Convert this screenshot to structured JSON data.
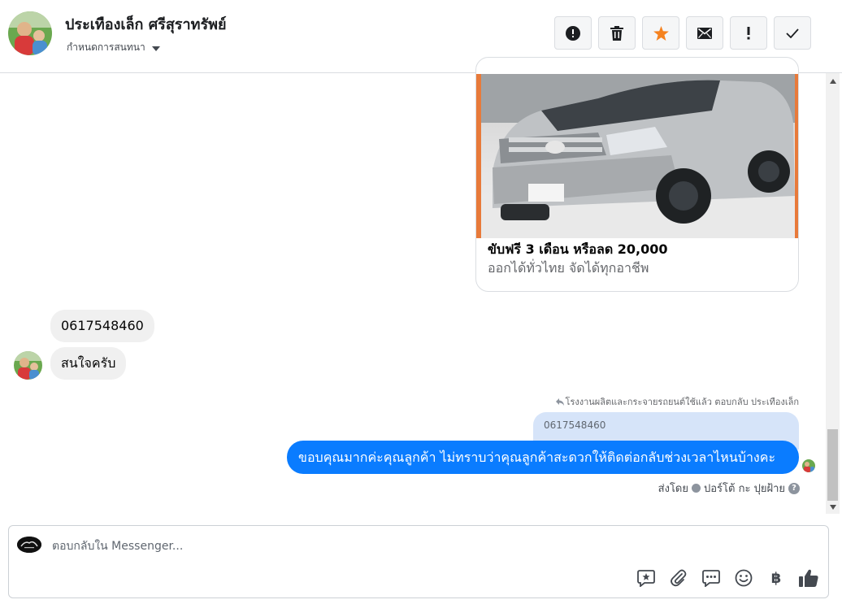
{
  "header": {
    "contact_name": "ประเทืองเล็ก ศรีสุราทรัพย์",
    "assign_label": "กำหนดการสนทนา",
    "toolbar": {
      "colors": {
        "star": "#f5821f"
      },
      "buttons": [
        {
          "icon": "alert-circle-icon"
        },
        {
          "icon": "trash-icon"
        },
        {
          "icon": "star-icon"
        },
        {
          "icon": "envelope-icon"
        },
        {
          "icon": "exclamation-icon"
        },
        {
          "icon": "checkmark-icon"
        }
      ]
    }
  },
  "ad_card": {
    "title": "ขับฟรี 3 เดือน หรือลด 20,000",
    "subtitle": "ออกได้ทั่วไทย จัดได้ทุกอาชีพ"
  },
  "messages": {
    "incoming": [
      {
        "text": "0617548460"
      },
      {
        "text": "สนใจครับ"
      }
    ],
    "reply_meta": "โรงงานผลิตและกระจายรถยนต์ใช้แล้ว ตอบกลับ ประเทืองเล็ก",
    "quoted_text": "0617548460",
    "outgoing_text": "ขอบคุณมากค่ะคุณลูกค้า ไม่ทราบว่าคุณลูกค้าสะดวกให้ติดต่อกลับช่วงเวลาไหนบ้างคะ",
    "sent_by_label": "ส่งโดย",
    "sent_by_name": "ปอร์โต้ กะ ปุยฝ้าย",
    "help_symbol": "?",
    "colors": {
      "outgoing_bubble": "#0a7cff",
      "incoming_bubble": "#f0f0f0"
    }
  },
  "composer": {
    "placeholder": "ตอบกลับใน Messenger...",
    "currency_symbol": "฿",
    "tools": [
      {
        "icon": "saved-reply-icon"
      },
      {
        "icon": "paperclip-icon"
      },
      {
        "icon": "chat-bubble-icon"
      },
      {
        "icon": "emoji-icon"
      },
      {
        "icon": "baht-icon"
      },
      {
        "icon": "thumbs-up-icon"
      }
    ]
  }
}
